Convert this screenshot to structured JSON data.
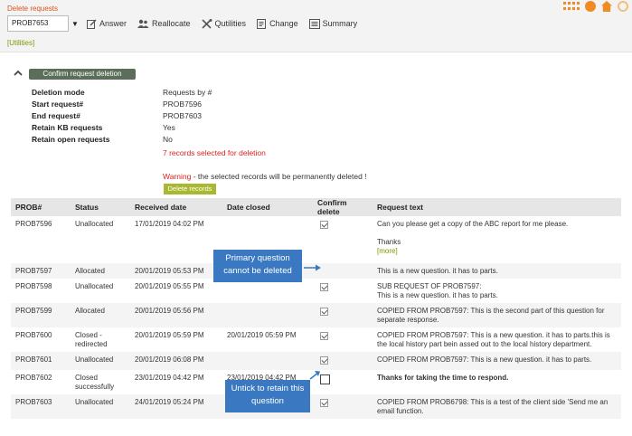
{
  "page": {
    "title": "Delete requests"
  },
  "toolbar": {
    "selected_request": "PROB7653",
    "answer": "Answer",
    "reallocate": "Reallocate",
    "qutilities": "Qutilities",
    "change": "Change",
    "summary": "Summary",
    "utilities_link": "[Utilities]"
  },
  "confirm_panel": {
    "button_label": "Confirm request deletion",
    "details": [
      {
        "label": "Deletion mode",
        "value": "Requests by #"
      },
      {
        "label": "Start request#",
        "value": "PROB7596"
      },
      {
        "label": "End request#",
        "value": "PROB7603"
      },
      {
        "label": "Retain KB requests",
        "value": "Yes"
      },
      {
        "label": "Retain open requests",
        "value": "No"
      }
    ],
    "selected_note": "7 records selected for deletion",
    "warning_prefix": "Warning",
    "warning_text": " - the selected records will be permanently deleted !",
    "delete_button": "Delete records"
  },
  "table": {
    "headers": [
      "PROB#",
      "Status",
      "Received date",
      "Date closed",
      "Confirm delete",
      "Request text"
    ],
    "rows": [
      {
        "id": "PROB7596",
        "status": "Unallocated",
        "received": "17/01/2019 04:02 PM",
        "closed": "",
        "confirm": "checked",
        "text": "Can you please get a copy of the ABC report for me please.",
        "text2": "Thanks",
        "more": "[more]"
      },
      {
        "id": "PROB7597",
        "status": "Allocated",
        "received": "20/01/2019 05:53 PM",
        "closed": "",
        "confirm": "none",
        "text": "This is a new question. it has to parts."
      },
      {
        "id": "PROB7598",
        "status": "Unallocated",
        "received": "20/01/2019 05:55 PM",
        "closed": "",
        "confirm": "checked",
        "text": "SUB REQUEST OF PROB7597:",
        "text2": "This is a new question. it has to parts."
      },
      {
        "id": "PROB7599",
        "status": "Allocated",
        "received": "20/01/2019 05:56 PM",
        "closed": "",
        "confirm": "checked",
        "text": "COPIED FROM PROB7597: This is the second part of this question for separate response."
      },
      {
        "id": "PROB7600",
        "status": "Closed - redirected",
        "received": "20/01/2019 05:59 PM",
        "closed": "20/01/2019 05:59 PM",
        "confirm": "checked",
        "text": "COPIED FROM PROB7597: This is a new question. it has to parts.this is the local history part bein assed out to the local history department."
      },
      {
        "id": "PROB7601",
        "status": "Unallocated",
        "received": "20/01/2019 06:08 PM",
        "closed": "",
        "confirm": "checked",
        "text": "COPIED FROM PROB7597: This is a new question. it has to parts."
      },
      {
        "id": "PROB7602",
        "status": "Closed successfully",
        "received": "23/01/2019 04:42 PM",
        "closed": "23/01/2019 04:42 PM",
        "confirm": "unchecked",
        "text": "Thanks for taking the time to respond.",
        "highlight": true
      },
      {
        "id": "PROB7603",
        "status": "Unallocated",
        "received": "24/01/2019 05:24 PM",
        "closed": "",
        "confirm": "checked",
        "text": "COPIED FROM PROB6798: This is a test of the client side 'Send me an email function."
      }
    ]
  },
  "callouts": {
    "primary": "Primary question cannot be deleted",
    "untick": "Untick to retain this question"
  },
  "colors": {
    "accent": "#f08a24",
    "link": "#7a9a01",
    "warning": "#d9231e",
    "callout": "#3a78c2"
  }
}
